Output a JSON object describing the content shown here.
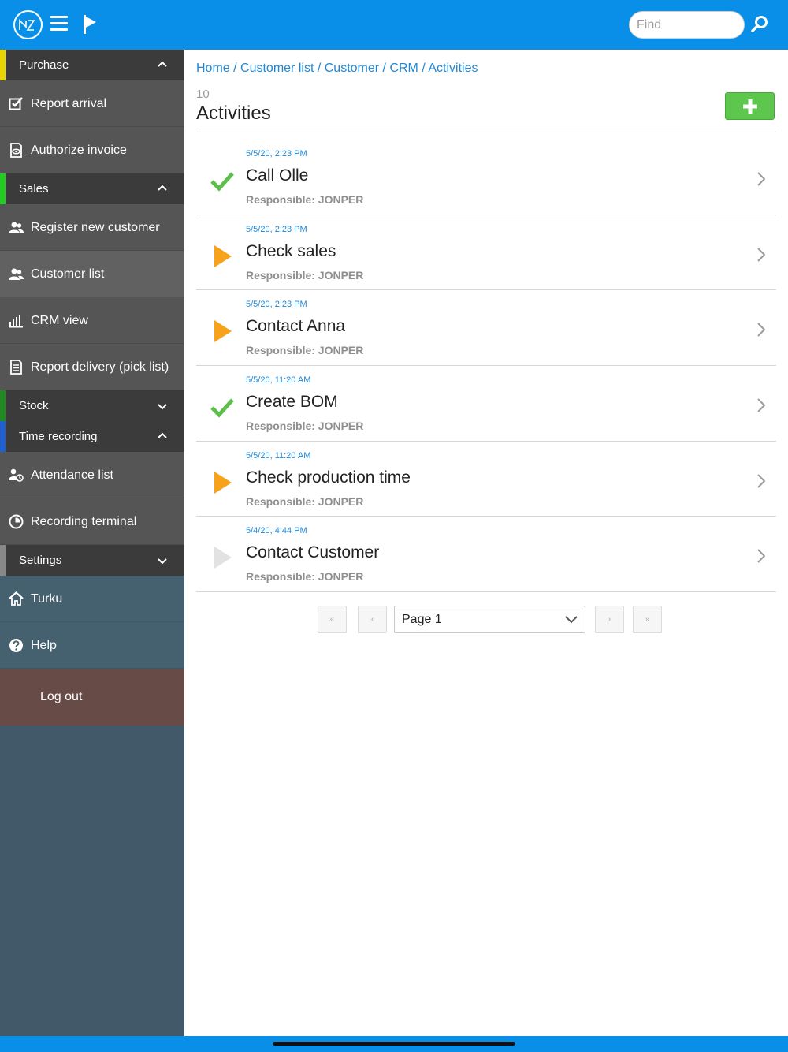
{
  "header": {
    "search_placeholder": "Find"
  },
  "sidebar": {
    "purchase": {
      "label": "Purchase",
      "accent": "#e8d400"
    },
    "purchase_items": [
      "Report arrival",
      "Authorize invoice"
    ],
    "sales": {
      "label": "Sales",
      "accent": "#22cc22"
    },
    "sales_items": [
      "Register new customer",
      "Customer list",
      "CRM view",
      "Report delivery (pick list)"
    ],
    "stock": {
      "label": "Stock",
      "accent": "#1f8a1f"
    },
    "time_recording": {
      "label": "Time recording",
      "accent": "#1f5fd0"
    },
    "time_items": [
      "Attendance list",
      "Recording terminal"
    ],
    "settings": {
      "label": "Settings",
      "accent": "#888888"
    },
    "site": "Turku",
    "help": "Help",
    "logout": "Log out"
  },
  "breadcrumb": [
    "Home",
    "Customer list",
    "Customer",
    "CRM",
    "Activities"
  ],
  "page": {
    "count": "10",
    "title": "Activities"
  },
  "activities": [
    {
      "date": "5/5/20, 2:23 PM",
      "name": "Call Olle",
      "responsible": "Responsible: JONPER",
      "status": "done"
    },
    {
      "date": "5/5/20, 2:23 PM",
      "name": "Check sales",
      "responsible": "Responsible: JONPER",
      "status": "open"
    },
    {
      "date": "5/5/20, 2:23 PM",
      "name": "Contact Anna",
      "responsible": "Responsible: JONPER",
      "status": "open"
    },
    {
      "date": "5/5/20, 11:20 AM",
      "name": "Create BOM",
      "responsible": "Responsible: JONPER",
      "status": "done"
    },
    {
      "date": "5/5/20, 11:20 AM",
      "name": "Check production time",
      "responsible": "Responsible: JONPER",
      "status": "open"
    },
    {
      "date": "5/4/20, 4:44 PM",
      "name": "Contact Customer",
      "responsible": "Responsible: JONPER",
      "status": "inactive"
    }
  ],
  "pager": {
    "first": "«",
    "prev": "‹",
    "selected_page": "Page 1",
    "next": "›",
    "last": "»"
  },
  "colors": {
    "topbar": "#0a8fe8",
    "link": "#1e88d6",
    "done": "#5cbf4a",
    "open": "#f7a21b",
    "inactive": "#e2e2e2",
    "add_button": "#5cc64d"
  }
}
